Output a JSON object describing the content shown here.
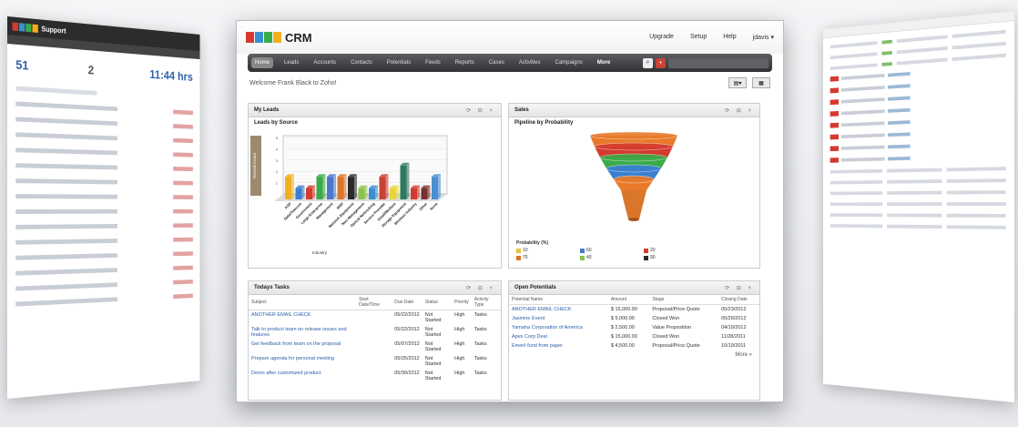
{
  "app": {
    "logo_text": "CRM",
    "logo_colors": [
      "#d43a2f",
      "#3a8fd1",
      "#3bab4a",
      "#f2b01e"
    ]
  },
  "toplinks": [
    "Upgrade",
    "Setup",
    "Help",
    "jdavis ▾"
  ],
  "nav": {
    "items": [
      "Home",
      "Leads",
      "Accounts",
      "Contacts",
      "Potentials",
      "Feeds",
      "Reports",
      "Cases",
      "Activities",
      "Campaigns",
      "More"
    ],
    "active": "Home"
  },
  "welcome": "Welcome Frank Black to Zoho!",
  "panels": {
    "leads": {
      "title": "My Leads",
      "subtitle": "Leads by Source",
      "ylabel": "Record Count",
      "xlabel": "Industry"
    },
    "sales": {
      "title": "Sales",
      "subtitle": "Pipeline by Probability",
      "legend_title": "Probability (%)"
    },
    "tasks": {
      "title": "Todays Tasks",
      "columns": [
        "Subject",
        "Start Date/Time",
        "Due Date",
        "Status",
        "Priority",
        "Activity Type"
      ],
      "rows": [
        [
          "ANOTHER EMAIL CHECK",
          "",
          "05/22/2012",
          "Not Started",
          "High",
          "Tasks"
        ],
        [
          "Talk to product team on release issues and features",
          "",
          "05/22/2012",
          "Not Started",
          "High",
          "Tasks"
        ],
        [
          "Get feedback from team on the proposal",
          "",
          "05/07/2012",
          "Not Started",
          "High",
          "Tasks"
        ],
        [
          "Prepare agenda for personal meeting",
          "",
          "05/25/2012",
          "Not Started",
          "High",
          "Tasks"
        ],
        [
          "Demo after customized product",
          "",
          "05/30/2012",
          "Not Started",
          "High",
          "Tasks"
        ]
      ]
    },
    "potentials": {
      "title": "Open Potentials",
      "columns": [
        "Potential Name",
        "Amount",
        "Stage",
        "Closing Date"
      ],
      "rows": [
        [
          "ANOTHER EMAIL CHECK",
          "$ 15,000.00",
          "Proposal/Price Quote",
          "05/23/2012"
        ],
        [
          "Jasmine Event",
          "$ 5,000.00",
          "Closed Won",
          "05/26/2012"
        ],
        [
          "Yamaha Corporation of America",
          "$ 2,500.00",
          "Value Proposition",
          "04/19/2012"
        ],
        [
          "Apex Corp Deal",
          "$ 15,000.00",
          "Closed Won",
          "11/28/2011"
        ],
        [
          "Emeril fund from paper",
          "$ 4,500.00",
          "Proposal/Price Quote",
          "10/19/2011"
        ]
      ],
      "more": "More »"
    }
  },
  "left_screen": {
    "brand": "Support",
    "stat1": "51",
    "stat2": "2",
    "stat3": "11:44 hrs"
  },
  "chart_data": [
    {
      "type": "bar",
      "title": "Leads by Source",
      "xlabel": "Industry",
      "ylabel": "Record Count",
      "categories": [
        "ASP",
        "Data/Telecom",
        "Government",
        "Large Enterprise",
        "Management",
        "MSP",
        "Network Equipment",
        "Non-Management",
        "Optical Networking",
        "Service Provider",
        "Small/Medium",
        "Storage Equipment",
        "Wireless Industry",
        "Other",
        "None"
      ],
      "values": [
        2,
        1,
        1,
        2,
        2,
        2,
        2,
        1,
        1,
        2,
        1,
        3,
        1,
        1,
        2
      ],
      "colors": [
        "#f2b01e",
        "#3a7fd1",
        "#d43a2f",
        "#3bab4a",
        "#4a79c9",
        "#d9762a",
        "#2a2a2a",
        "#8bc34a",
        "#3a8fd1",
        "#c94133",
        "#e8d63b",
        "#2f7a5e",
        "#d43a2f",
        "#7a2f2f",
        "#4a8fd1"
      ],
      "ylim": [
        0,
        5
      ]
    },
    {
      "type": "funnel",
      "title": "Pipeline by Probability",
      "series": [
        {
          "name": "10",
          "color": "#e8c33b"
        },
        {
          "name": "60",
          "color": "#4a79c9"
        },
        {
          "name": "20",
          "color": "#d43a2f"
        },
        {
          "name": "75",
          "color": "#d9762a"
        },
        {
          "name": "40",
          "color": "#8bc34a"
        },
        {
          "name": "90",
          "color": "#2a2a2a"
        }
      ],
      "layer_colors": [
        "#e87a2a",
        "#d43a2f",
        "#3bab4a",
        "#3a7fd1",
        "#e87a2a"
      ]
    }
  ]
}
